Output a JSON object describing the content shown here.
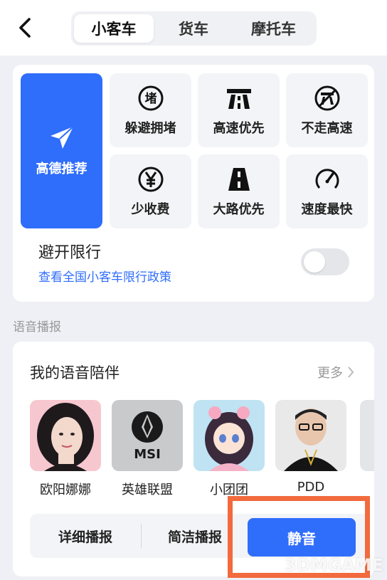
{
  "header": {
    "tabs": [
      {
        "label": "小客车",
        "active": true
      },
      {
        "label": "货车",
        "active": false
      },
      {
        "label": "摩托车",
        "active": false
      }
    ]
  },
  "route": {
    "recommend_label": "高德推荐",
    "options": [
      {
        "label": "躲避拥堵",
        "icon": "congestion-icon"
      },
      {
        "label": "高速优先",
        "icon": "highway-icon"
      },
      {
        "label": "不走高速",
        "icon": "no-highway-icon"
      },
      {
        "label": "少收费",
        "icon": "yuan-icon"
      },
      {
        "label": "大路优先",
        "icon": "main-road-icon"
      },
      {
        "label": "速度最快",
        "icon": "speedometer-icon"
      }
    ],
    "congestion_glyph": "堵",
    "restriction": {
      "title": "避开限行",
      "link": "查看全国小客车限行政策",
      "enabled": false
    }
  },
  "voice_section_label": "语音播报",
  "voice": {
    "title": "我的语音陪伴",
    "more_label": "更多",
    "avatars": [
      {
        "name": "欧阳娜娜"
      },
      {
        "name": "英雄联盟",
        "logo_text": "MSI"
      },
      {
        "name": "小团团"
      },
      {
        "name": "PDD"
      }
    ],
    "modes": {
      "detailed": "详细播报",
      "concise": "简洁播报",
      "mute": "静音"
    }
  },
  "watermark": "3DMGAME",
  "colors": {
    "accent": "#2f6dfb",
    "highlight": "#f26a3d"
  }
}
